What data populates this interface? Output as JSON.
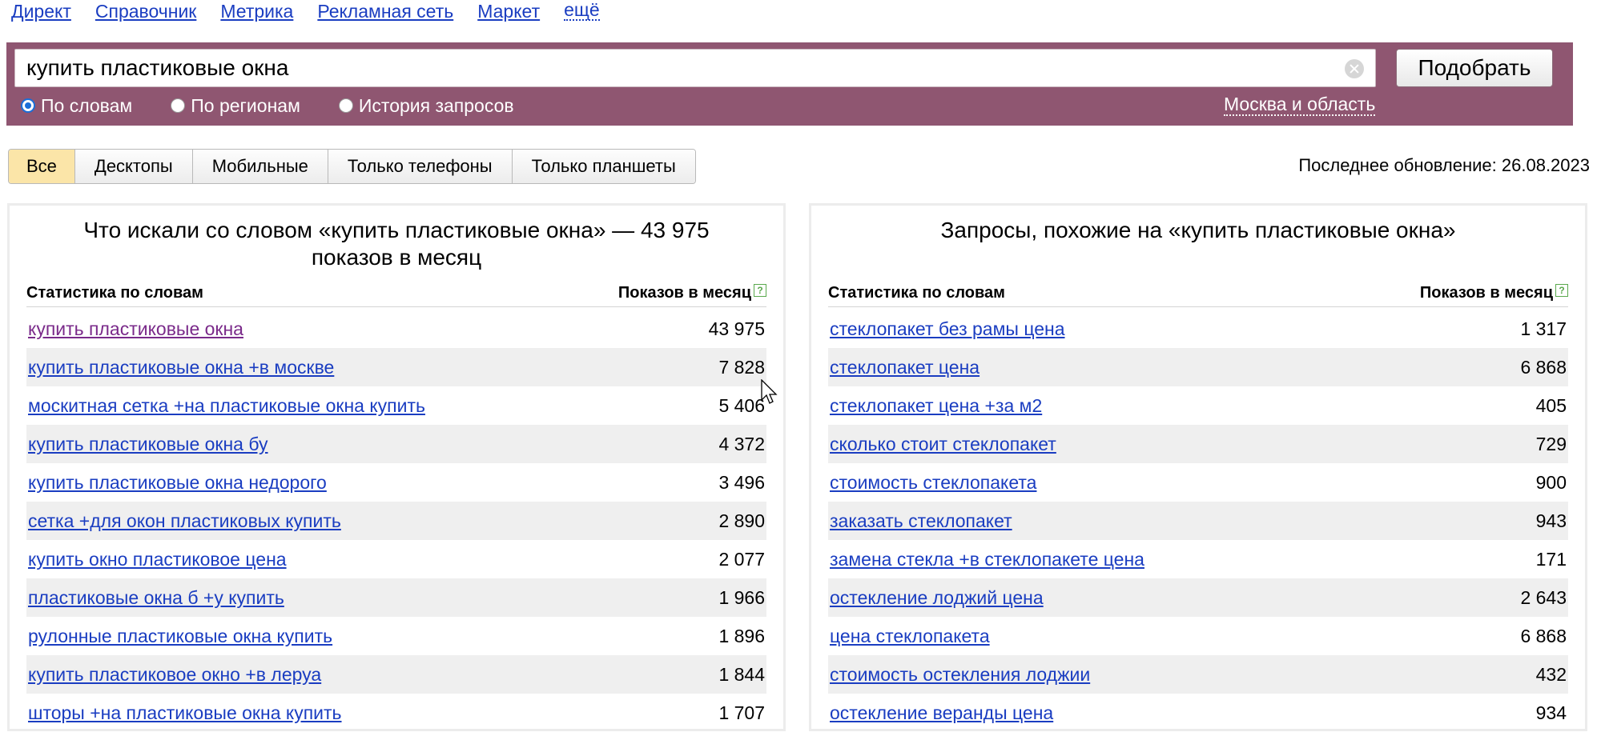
{
  "nav": [
    "Директ",
    "Справочник",
    "Метрика",
    "Рекламная сеть",
    "Маркет",
    "ещё"
  ],
  "search": {
    "value": "купить пластиковые окна",
    "submit_label": "Подобрать",
    "modes": [
      "По словам",
      "По регионам",
      "История запросов"
    ],
    "selected_mode": "По словам",
    "region": "Москва и область"
  },
  "tabs": [
    "Все",
    "Десктопы",
    "Мобильные",
    "Только телефоны",
    "Только планшеты"
  ],
  "active_tab": "Все",
  "last_update": "Последнее обновление: 26.08.2023",
  "left": {
    "title": "Что искали со словом «купить пластиковые окна» — 43 975 показов в месяц",
    "col_query": "Статистика по словам",
    "col_count": "Показов в месяц",
    "rows": [
      {
        "q": "купить пластиковые окна",
        "n": "43 975",
        "visited": true
      },
      {
        "q": "купить пластиковые окна +в москве",
        "n": "7 828"
      },
      {
        "q": "москитная сетка +на пластиковые окна купить",
        "n": "5 406"
      },
      {
        "q": "купить пластиковые окна бу",
        "n": "4 372"
      },
      {
        "q": "купить пластиковые окна недорого",
        "n": "3 496"
      },
      {
        "q": "сетка +для окон пластиковых купить",
        "n": "2 890"
      },
      {
        "q": "купить окно пластиковое цена",
        "n": "2 077"
      },
      {
        "q": "пластиковые окна б +у купить",
        "n": "1 966"
      },
      {
        "q": "рулонные пластиковые окна купить",
        "n": "1 896"
      },
      {
        "q": "купить пластиковое окно +в леруа",
        "n": "1 844"
      },
      {
        "q": "шторы +на пластиковые окна купить",
        "n": "1 707"
      }
    ]
  },
  "right": {
    "title": "Запросы, похожие на «купить пластиковые окна»",
    "col_query": "Статистика по словам",
    "col_count": "Показов в месяц",
    "rows": [
      {
        "q": "стеклопакет без рамы цена",
        "n": "1 317"
      },
      {
        "q": "стеклопакет цена",
        "n": "6 868"
      },
      {
        "q": "стеклопакет цена +за м2",
        "n": "405"
      },
      {
        "q": "сколько стоит стеклопакет",
        "n": "729"
      },
      {
        "q": "стоимость стеклопакета",
        "n": "900"
      },
      {
        "q": "заказать стеклопакет",
        "n": "943"
      },
      {
        "q": "замена стекла +в стеклопакете цена",
        "n": "171"
      },
      {
        "q": "остекление лоджий цена",
        "n": "2 643"
      },
      {
        "q": "цена стеклопакета",
        "n": "6 868"
      },
      {
        "q": "стоимость остекления лоджии",
        "n": "432"
      },
      {
        "q": "остекление веранды цена",
        "n": "934"
      }
    ]
  }
}
